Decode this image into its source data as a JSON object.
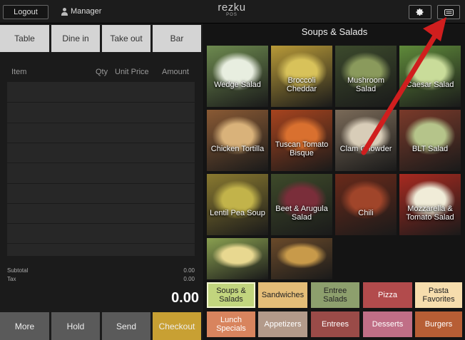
{
  "topbar": {
    "logout_label": "Logout",
    "user_name": "Manager",
    "logo_main": "rezku",
    "logo_sub": "POS"
  },
  "order_types": [
    "Table",
    "Dine in",
    "Take out",
    "Bar"
  ],
  "order_columns": {
    "item": "Item",
    "qty": "Qty",
    "unit_price": "Unit Price",
    "amount": "Amount"
  },
  "totals": {
    "subtotal_label": "Subtotal",
    "subtotal_value": "0.00",
    "tax_label": "Tax",
    "tax_value": "0.00",
    "grand_total": "0.00"
  },
  "actions": {
    "more": "More",
    "hold": "Hold",
    "send": "Send",
    "checkout": "Checkout"
  },
  "menu": {
    "category_title": "Soups & Salads",
    "items": [
      {
        "label": "Wedge Salad",
        "bg": "#6d8a4f",
        "accent": "#e8eee0"
      },
      {
        "label": "Broccoli Cheddar",
        "bg": "#b89a38",
        "accent": "#d8c25a"
      },
      {
        "label": "Mushroom Salad",
        "bg": "#3c4a2c",
        "accent": "#8a9a5c"
      },
      {
        "label": "Caesar Salad",
        "bg": "#5f8a3a",
        "accent": "#c9dc9a"
      },
      {
        "label": "Chicken Tortilla",
        "bg": "#8a5a34",
        "accent": "#d9b27a"
      },
      {
        "label": "Tuscan Tomato Bisque",
        "bg": "#a8441e",
        "accent": "#d9702f"
      },
      {
        "label": "Clam Chowder",
        "bg": "#7a6a58",
        "accent": "#d8cdb8"
      },
      {
        "label": "BLT Salad",
        "bg": "#7a3a2a",
        "accent": "#b5c48a"
      },
      {
        "label": "Lentil Pea Soup",
        "bg": "#8a7a30",
        "accent": "#c2b34a"
      },
      {
        "label": "Beet & Arugula Salad",
        "bg": "#3e4a2a",
        "accent": "#7a2e3a"
      },
      {
        "label": "Chili",
        "bg": "#6a2a1a",
        "accent": "#a0452a"
      },
      {
        "label": "Mozzarella & Tomato Salad",
        "bg": "#a82a20",
        "accent": "#f0ecd8"
      },
      {
        "label": "",
        "bg": "#8aa050",
        "accent": "#e8d890"
      },
      {
        "label": "",
        "bg": "#6a4a2a",
        "accent": "#c89a4a"
      }
    ]
  },
  "categories": [
    {
      "label": "Soups & Salads",
      "color": "#c2d57e",
      "selected": true
    },
    {
      "label": "Sandwiches",
      "color": "#e4bd78"
    },
    {
      "label": "Entree Salads",
      "color": "#8d9f6d"
    },
    {
      "label": "Pizza",
      "color": "#b24b4c"
    },
    {
      "label": "Pasta Favorites",
      "color": "#f6ddad"
    },
    {
      "label": "Lunch Specials",
      "color": "#d8845e"
    },
    {
      "label": "Appetizers",
      "color": "#b39a8a"
    },
    {
      "label": "Entrees",
      "color": "#9a4b48"
    },
    {
      "label": "Desserts",
      "color": "#c06e86"
    },
    {
      "label": "Burgers",
      "color": "#b75e35"
    }
  ],
  "colors": {
    "checkout": "#c8a033",
    "annotation_arrow": "#d01e1e"
  }
}
